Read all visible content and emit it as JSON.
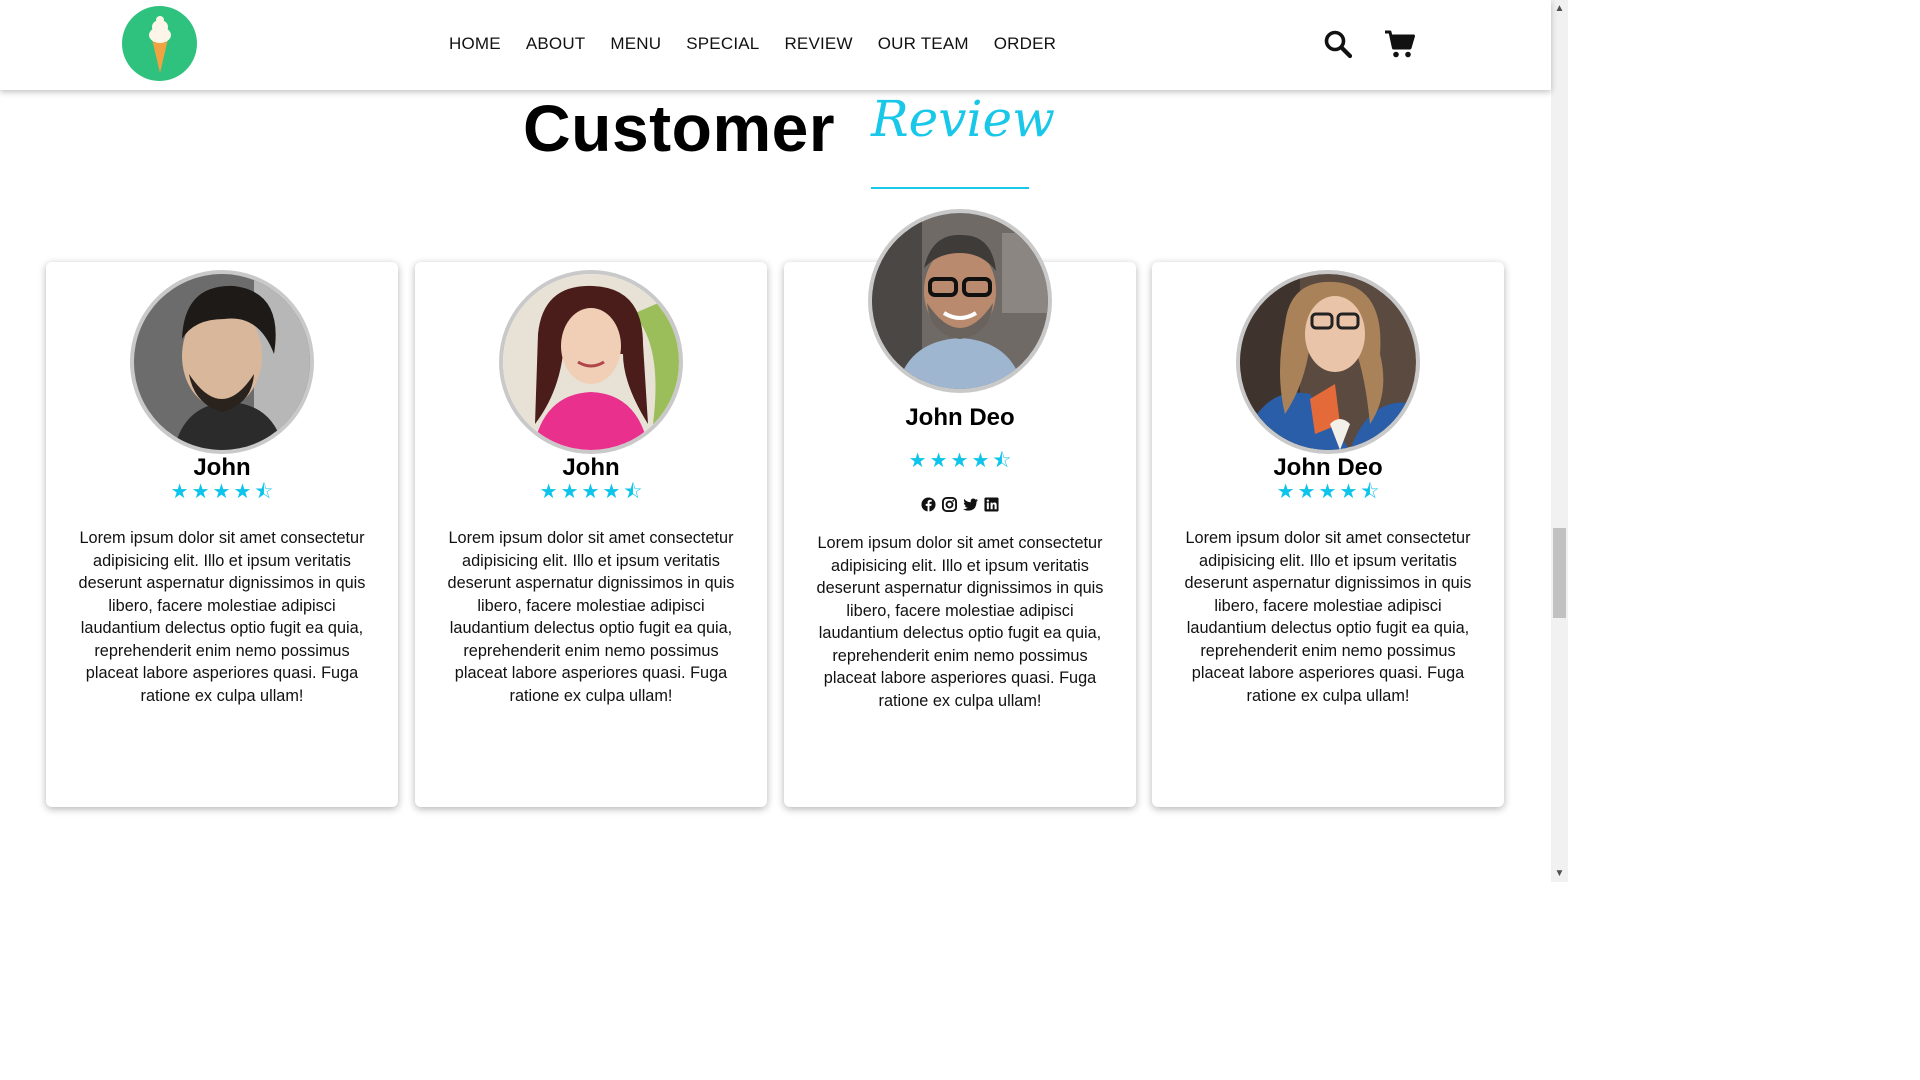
{
  "nav": {
    "items": [
      "HOME",
      "ABOUT",
      "MENU",
      "SPECIAL",
      "REVIEW",
      "OUR TEAM",
      "ORDER"
    ]
  },
  "icons": {
    "logo": "ice-cream-icon",
    "search": "search-icon",
    "cart": "cart-icon"
  },
  "section": {
    "title_main": "Customer",
    "title_accent": "Review"
  },
  "colors": {
    "accent": "#19c8e8",
    "star": "#0fc4ea",
    "logo_bg": "#2ec27e"
  },
  "reviews": [
    {
      "name": "John",
      "rating": 4.5,
      "text": "Lorem ipsum dolor sit amet consectetur adipisicing elit. Illo et ipsum veritatis deserunt aspernatur dignissimos in quis libero, facere molestiae adipisci laudantium delectus optio fugit ea quia, reprehenderit enim nemo possimus placeat labore asperiores quasi. Fuga ratione ex culpa ullam!"
    },
    {
      "name": "John",
      "rating": 4.5,
      "text": "Lorem ipsum dolor sit amet consectetur adipisicing elit. Illo et ipsum veritatis deserunt aspernatur dignissimos in quis libero, facere molestiae adipisci laudantium delectus optio fugit ea quia, reprehenderit enim nemo possimus placeat labore asperiores quasi. Fuga ratione ex culpa ullam!"
    },
    {
      "name": "John Deo",
      "rating": 4.5,
      "socials": [
        "facebook-icon",
        "instagram-icon",
        "twitter-icon",
        "linkedin-icon"
      ],
      "text": "Lorem ipsum dolor sit amet consectetur adipisicing elit. Illo et ipsum veritatis deserunt aspernatur dignissimos in quis libero, facere molestiae adipisci laudantium delectus optio fugit ea quia, reprehenderit enim nemo possimus placeat labore asperiores quasi. Fuga ratione ex culpa ullam!"
    },
    {
      "name": "John Deo",
      "rating": 4.5,
      "text": "Lorem ipsum dolor sit amet consectetur adipisicing elit. Illo et ipsum veritatis deserunt aspernatur dignissimos in quis libero, facere molestiae adipisci laudantium delectus optio fugit ea quia, reprehenderit enim nemo possimus placeat labore asperiores quasi. Fuga ratione ex culpa ullam!"
    }
  ]
}
